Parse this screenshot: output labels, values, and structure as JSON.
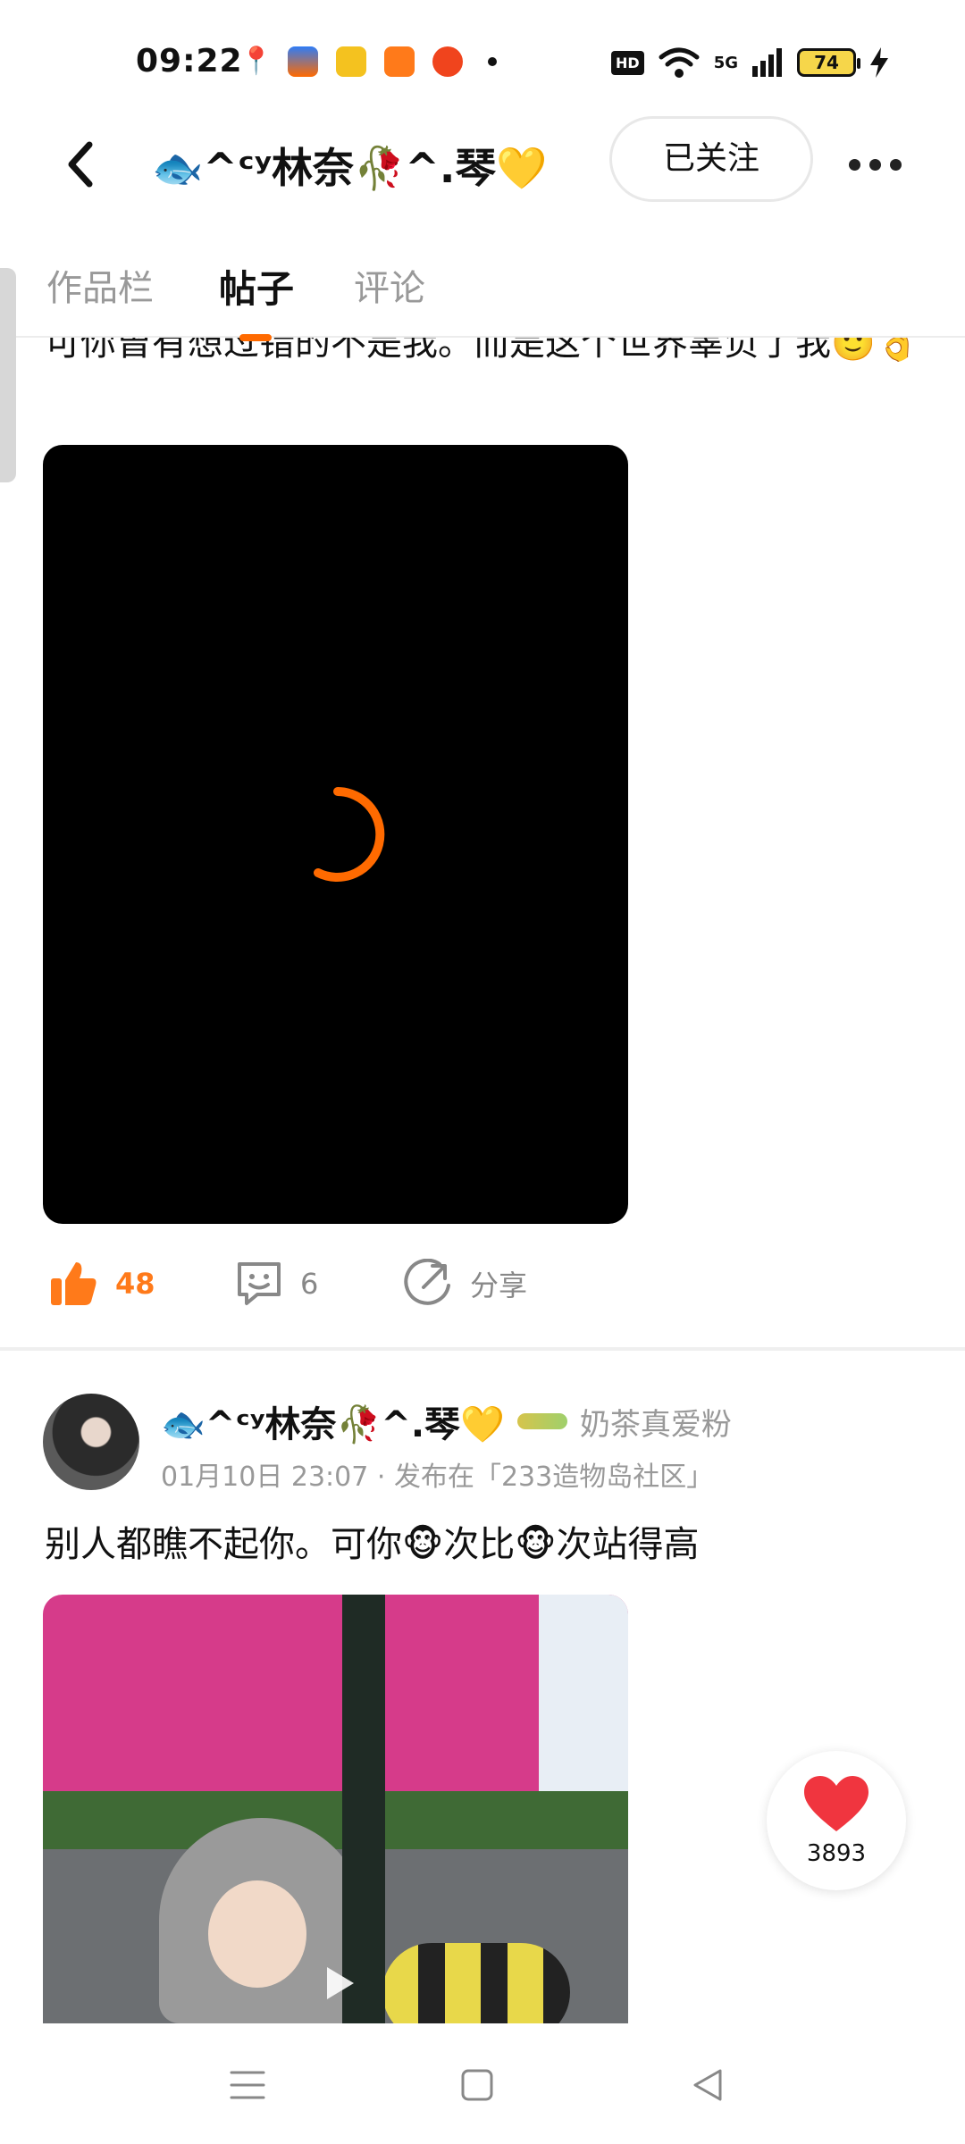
{
  "status_bar": {
    "time": "09:22",
    "battery": "74",
    "network": "5G",
    "hd": "HD"
  },
  "header": {
    "title": "🐟^ᶜʸ林奈🥀^.琴💛",
    "follow_label": "已关注"
  },
  "tabs": [
    {
      "label": "作品栏"
    },
    {
      "label": "帖子"
    },
    {
      "label": "评论"
    }
  ],
  "posts": [
    {
      "text": "可你曾有想过错的不是我。而是这个世界辜负了我🙂👌",
      "actions": {
        "likes": "48",
        "comments": "6",
        "share_label": "分享"
      }
    },
    {
      "author": "🐟^ᶜʸ林奈🥀^.琴💛",
      "fan_label": "奶茶真爱粉",
      "meta": "01月10日 23:07 · 发布在「233造物岛社区」",
      "text": "别人都瞧不起你。可你🐵次比🐵次站得高"
    }
  ],
  "floating_like": {
    "count": "3893"
  },
  "colors": {
    "accent": "#ff6a00",
    "like": "#ff7a1a",
    "heart": "#f0353f"
  }
}
